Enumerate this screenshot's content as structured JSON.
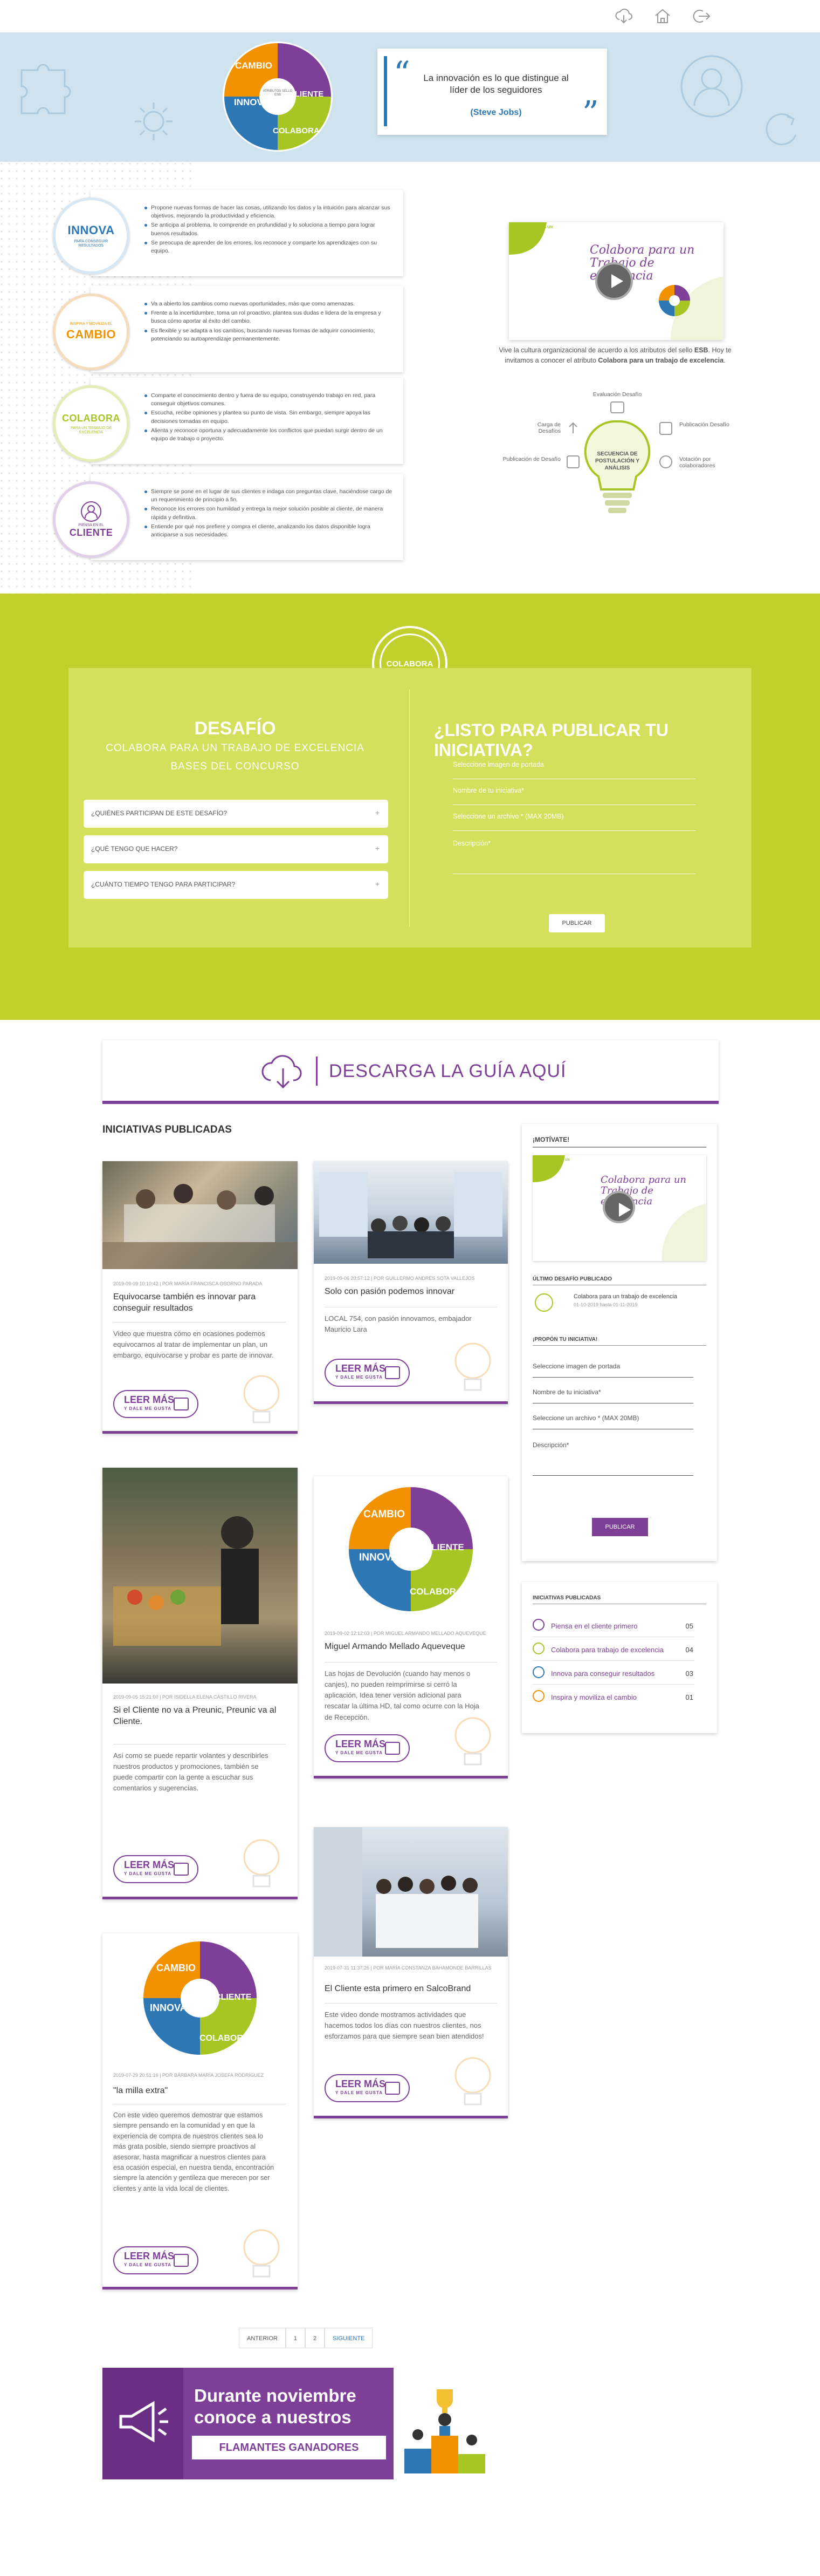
{
  "header": {
    "icons": [
      "cloud-download-icon",
      "home-icon",
      "logout-icon"
    ]
  },
  "hero": {
    "logo_words": {
      "cambio": "CAMBIO",
      "cambio_top": "INSPIRA Y MOVILIZA EL",
      "innova": "INNOVA",
      "innova_sub": "PARA CONSEGUIR RESULTADOS",
      "cliente": "CLIENTE",
      "cliente_top": "PIENSA EN EL",
      "colabora": "COLABORA",
      "colabora_sub": "PARA UN TRABAJO DE EXCELENCIA",
      "center": "ATRIBUTOS SELLO ESB"
    },
    "quote": "La innovación es lo que distingue al líder de los seguidores",
    "author": "(Steve Jobs)",
    "colors": {
      "orange": "#f39200",
      "blue": "#2d77b5",
      "green": "#a7c523",
      "purple": "#7d3f98"
    }
  },
  "attributes": [
    {
      "word": "INNOVA",
      "top": "",
      "sub": "PARA CONSEGUIR RESULTADOS",
      "color": "#2d77b5",
      "items": [
        "Propone nuevas formas de hacer las cosas, utilizando los datos y la intuición para alcanzar sus objetivos, mejorando la productividad y eficiencia.",
        "Se anticipa al problema, lo comprende en profundidad y lo soluciona a tiempo para lograr buenos resultados.",
        "Se preocupa de aprender de los errores, los reconoce y comparte los aprendizajes con su equipo."
      ]
    },
    {
      "word": "CAMBIO",
      "top": "INSPIRA Y MOVILIZA EL",
      "sub": "",
      "color": "#f39200",
      "items": [
        "Va a abierto los cambios como nuevas oportunidades, más que como amenazas.",
        "Frente a la incertidumbre, toma un rol proactivo, plantea sus dudas e lidera de la empresa y busca cómo aportar al éxito del cambio.",
        "Es flexible y se adapta a los cambios, buscando nuevas formas de adquirir conocimiento, potenciando su autoaprendizaje permanentemente."
      ]
    },
    {
      "word": "COLABORA",
      "top": "",
      "sub": "PARA UN TRABAJO DE EXCELENCIA",
      "color": "#a7c523",
      "items": [
        "Comparte el conocimiento dentro y fuera de su equipo, construyendo trabajo en red, para conseguir objetivos comunes.",
        "Escucha, recibe opiniones y plantea su punto de vista. Sin embargo, siempre apoya las decisiones tomadas en equipo.",
        "Alienta y reconoce oportuna y adecuadamente los conflictos que puedan surgir dentro de un equipo de trabajo o proyecto."
      ]
    },
    {
      "word": "CLIENTE",
      "top": "PIENSA EN EL",
      "sub": "",
      "color": "#7d3f98",
      "items": [
        "Siempre se pone en el lugar de sus clientes e indaga con preguntas clave, haciéndose cargo de un requerimiento de principio a fin.",
        "Reconoce los errores con humildad y entrega la mejor solución posible al cliente, de manera rápida y definitiva.",
        "Entiende por qué nos prefiere y compra el cliente, analizando los datos disponible logra anticiparse a sus necesidades."
      ]
    }
  ],
  "video": {
    "badge": "COLABORA PARA UN TRABAJO DE EXCELENCIA",
    "script_title": "Colabora para un Trabajo de excelencia",
    "text_a": "Vive la cultura organizacional de acuerdo a los atributos del sello ",
    "text_b": "ESB",
    "text_c": ". Hoy te invitamos a conocer el atributo ",
    "text_d": "Colabora para un trabajo de excelencia",
    "text_e": "."
  },
  "sequence": {
    "center": "SECUENCIA DE POSTULACIÓN Y ANÁLISIS",
    "steps": [
      "Evaluación Desafío",
      "Publicación Desafío",
      "Votación por colaboradores",
      "Publicación de Desafío",
      "Carga de Desafíos"
    ]
  },
  "challenge": {
    "logo_word": "COLABORA",
    "title": "DESAFÍO",
    "subtitle": "COLABORA PARA UN TRABAJO DE EXCELENCIA",
    "bases": "BASES DEL CONCURSO",
    "faqs": [
      "¿QUIÉNES PARTICIPAN DE ESTE DESAFÍO?",
      "¿QUÉ TENGO QUE HACER?",
      "¿CUÁNTO TIEMPO TENGO PARA PARTICIPAR?"
    ],
    "form_title": "¿LISTO PARA PUBLICAR TU INICIATIVA?",
    "fields": [
      "Seleccione imagen de portada",
      "Nombre de tu iniciativa*",
      "Seleccione un archivo * (MAX 20MB)",
      "Descripción*"
    ],
    "button": "PUBLICAR"
  },
  "guide": {
    "label": "DESCARGA LA GUÍA AQUÍ"
  },
  "initiatives": {
    "heading": "INICIATIVAS PUBLICADAS",
    "read_more": "LEER MÁS",
    "like_text": "Y DALE ME GUSTA",
    "posts": [
      {
        "meta": "2019-09-09 10:10:42 | POR MARÍA FRANCISCA OSORNO PARADA",
        "title": "Equivocarse también es innovar para conseguir resultados",
        "excerpt": "Video que muestra cómo en ocasiones podemos equivocarnos al tratar de implementar un plan, un embargo, equivocarse y probar es parte de innovar."
      },
      {
        "meta": "2019-09-06 20:57:12 | POR GUILLERMO ANDRÉS SOTA VALLEJOS",
        "title": "Solo con pasión podemos innovar",
        "excerpt": "LOCAL 754, con pasión innovamos, embajador Mauricio Lara"
      },
      {
        "meta": "2019-09-05 15:21:00 | POR ISIDELLA ELENA CASTILLO RIVERA",
        "title": "Si el Cliente no va a Preunic, Preunic va al Cliente.",
        "excerpt": "Así como se puede repartir volantes y describirles nuestros productos y promociones, también se puede compartir con la gente a escuchar sus comentarios y sugerencias."
      },
      {
        "meta": "2019-09-02 12:12:03 | POR MIGUEL ARMANDO MELLADO AQUEVEQUE",
        "title": "Miguel Armando Mellado Aqueveque",
        "excerpt": "Las hojas de Devolución (cuando hay menos o canjes), no pueden reimprimirse si cerró la aplicación, Idea tener versión adicional para rescatar la última HD, tal como ocurre con la Hoja de Recepción."
      },
      {
        "meta": "2019-07-31 11:37:26 | POR MARÍA CONSTANZA BAHAMONDE BARRILLAS",
        "title": "El Cliente esta primero en SalcoBrand",
        "excerpt": "Este video donde mostramos actividades que hacemos todos los días con nuestros clientes, nos esforzamos para que siempre sean bien atendidos!"
      },
      {
        "meta": "2019-07-29 20:51:16 | POR BÁRBARA MARÍA JOSEFA RODRÍGUEZ",
        "title": "\"la milla extra\"",
        "excerpt": "Con este video queremos demostrar que estamos siempre pensando en la comunidad y en que la experiencia de compra de nuestros clientes sea lo más grata posible, siendo siempre proactivos al asesorar, hasta magnificar a nuestros clientes para esa ocasión especial, en nuestra tienda, encontración siempre la atención y gentileza que merecen por ser clientes y ante la vida local de clientes."
      }
    ]
  },
  "sidebar": {
    "motivate_heading": "¡MOTÍVATE!",
    "last_heading": "ÚLTIMO DESAFÍO PUBLICADO",
    "last_title": "Colabora para un trabajo de excelencia",
    "last_dates": "01-10-2019 hasta 01-11-2019",
    "propose_heading": "¡PROPÓN TU INICIATIVA!",
    "fields": [
      "Seleccione imagen de portada",
      "Nombre de tu iniciativa*",
      "Seleccione un archivo * (MAX 20MB)",
      "Descripción*"
    ],
    "button": "PUBLICAR",
    "list_heading": "INICIATIVAS PUBLICADAS",
    "categories": [
      {
        "label": "Piensa en el cliente primero",
        "count": "05"
      },
      {
        "label": "Colabora para trabajo de excelencia",
        "count": "04"
      },
      {
        "label": "Innova para conseguir resultados",
        "count": "03"
      },
      {
        "label": "Inspira y moviliza el cambio",
        "count": "01"
      }
    ]
  },
  "pagination": {
    "prev": "ANTERIOR",
    "pages": [
      "1",
      "2"
    ],
    "next": "SIGUIENTE"
  },
  "banner": {
    "line1": "Durante noviembre",
    "line2": "conoce a nuestros",
    "ribbon": "FLAMANTES GANADORES"
  }
}
